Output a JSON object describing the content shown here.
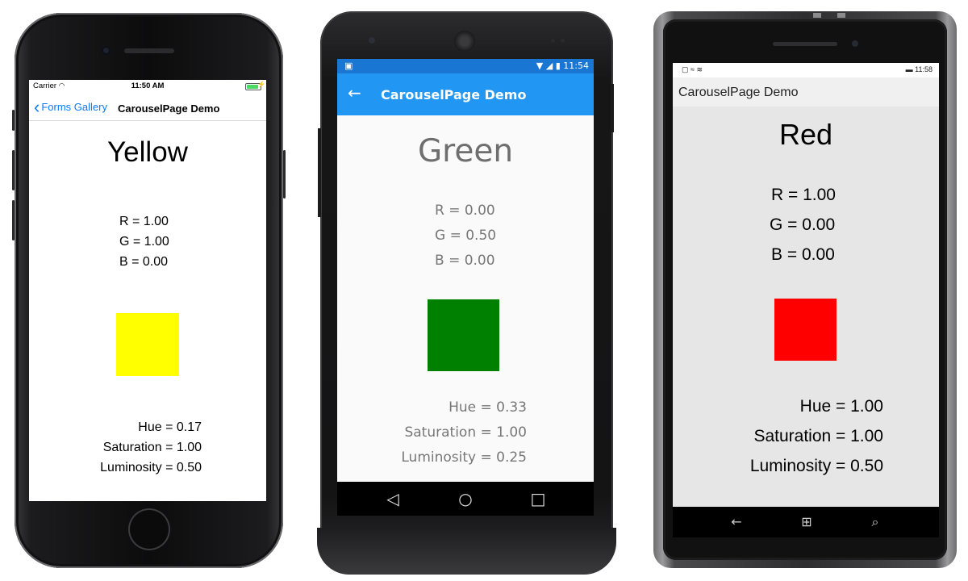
{
  "ios": {
    "status": {
      "carrier": "Carrier",
      "time": "11:50 AM",
      "battery_level": 1.0
    },
    "nav": {
      "back_label": "Forms Gallery",
      "title": "CarouselPage Demo"
    },
    "color_name": "Yellow",
    "rgb": [
      "R = 1.00",
      "G = 1.00",
      "B = 0.00"
    ],
    "swatch_color": "#ffff00",
    "hsl": [
      "Hue = 0.17",
      "Saturation = 1.00",
      "Luminosity = 0.50"
    ]
  },
  "android": {
    "status": {
      "time": "11:54",
      "app_icon": "android-robot-icon"
    },
    "toolbar": {
      "title": "CarouselPage Demo",
      "back_icon": "arrow-left-icon",
      "bar_color": "#2196f3",
      "status_color": "#1976d2"
    },
    "color_name": "Green",
    "rgb": [
      "R = 0.00",
      "G = 0.50",
      "B = 0.00"
    ],
    "swatch_color": "#008000",
    "hsl": [
      "Hue = 0.33",
      "Saturation = 1.00",
      "Luminosity = 0.25"
    ],
    "navbar": [
      "back-triangle-icon",
      "home-circle-icon",
      "recents-square-icon"
    ]
  },
  "windows": {
    "status": {
      "time": "11:58"
    },
    "title": "CarouselPage Demo",
    "color_name": "Red",
    "rgb": [
      "R = 1.00",
      "G = 0.00",
      "B = 0.00"
    ],
    "swatch_color": "#ff0000",
    "hsl": [
      "Hue = 1.00",
      "Saturation = 1.00",
      "Luminosity = 0.50"
    ],
    "navbar": [
      "back-arrow-icon",
      "windows-start-icon",
      "search-icon"
    ]
  }
}
